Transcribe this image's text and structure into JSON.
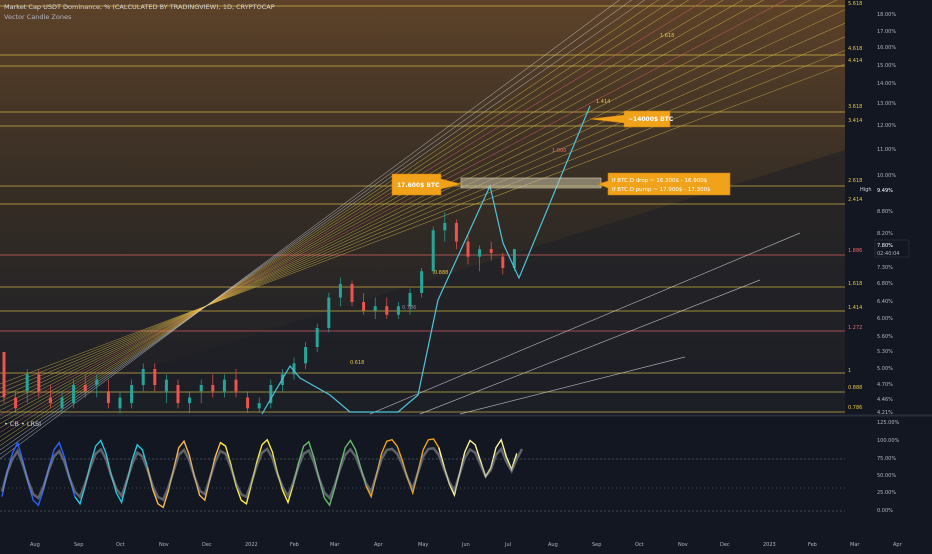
{
  "header": {
    "symbol_line": "Market Cap USDT Dominance, %  (CALCULATED BY TRADINGVIEW), 1D, CRYPTOCAP",
    "indicator_line": "Vector Candle Zones"
  },
  "oscillator": {
    "label": "• CB • LRSI",
    "axis_labels": [
      "125.00%",
      "100.00%",
      "75.00%",
      "50.00%",
      "25.00%",
      "0.00%"
    ]
  },
  "price_axis": {
    "labels": [
      "18.00%",
      "17.00%",
      "16.00%",
      "15.00%",
      "14.00%",
      "13.00%",
      "12.00%",
      "11.00%",
      "10.00%",
      "8.80%",
      "8.20%",
      "7.30%",
      "6.80%",
      "6.40%",
      "6.00%",
      "5.60%",
      "5.30%",
      "5.00%",
      "4.70%",
      "4.46%",
      "4.21%"
    ],
    "high_label": "High",
    "high_value": "9.49%",
    "current_value": "7.80%",
    "countdown": "02:40:04"
  },
  "time_axis": {
    "labels": [
      "Aug",
      "Sep",
      "Oct",
      "Nov",
      "Dec",
      "2022",
      "Feb",
      "Mar",
      "Apr",
      "May",
      "Jun",
      "Jul",
      "Aug",
      "Sep",
      "Oct",
      "Nov",
      "Dec",
      "2023",
      "Feb",
      "Mar",
      "Apr"
    ]
  },
  "fib_levels": [
    "5.618",
    "4.618",
    "4.414",
    "3.618",
    "3.414",
    "2.618",
    "2.414",
    "1.886",
    "1.618",
    "1.414",
    "1.272",
    "1",
    "0.888",
    "0.786"
  ],
  "chart_labels": {
    "diag_1618": "1.618",
    "diag_1414": "1.414",
    "diag_1000": "1.000",
    "level_0888": "0.888",
    "level_0786": "0.786",
    "level_0618": "0.618"
  },
  "annotations": {
    "target_btc": "~14000$ BTC",
    "zone_btc": "17.600$ BTC",
    "drop_text": "If BTC.D drop ~ 16.300$ - 16.900$",
    "pump_text": "If BTC.D pump ~ 17.900$ - 17.300$"
  },
  "colors": {
    "background": "#131722",
    "fib_line": "#e8c547",
    "fib_red": "#f06a6a",
    "projection": "#4fc3d9",
    "callout": "#f0a21b",
    "candle_up": "#26a69a",
    "candle_down": "#ef5350"
  },
  "chart_data": [
    {
      "type": "candlestick",
      "title": "Market Cap USDT Dominance, %  (CALCULATED BY TRADINGVIEW), 1D, CRYPTOCAP",
      "x": [
        "Aug",
        "Sep",
        "Oct",
        "Nov",
        "Dec",
        "2022",
        "Feb",
        "Mar",
        "Apr",
        "May",
        "Jun",
        "Jul"
      ],
      "y_unit": "%",
      "ylim": [
        4.21,
        18.0
      ],
      "last_value": 7.8,
      "high_value": 9.49,
      "series": [
        {
          "values": [
            [
              5.3,
              5.3,
              4.4,
              4.5
            ],
            [
              4.5,
              4.6,
              4.2,
              4.3
            ],
            [
              4.6,
              5.0,
              4.4,
              4.9
            ],
            [
              4.9,
              5.0,
              4.5,
              4.6
            ],
            [
              4.5,
              4.7,
              4.3,
              4.4
            ],
            [
              4.3,
              4.6,
              4.2,
              4.5
            ],
            [
              4.4,
              4.8,
              4.3,
              4.7
            ],
            [
              4.7,
              4.9,
              4.5,
              4.6
            ],
            [
              4.7,
              4.9,
              4.5,
              4.8
            ],
            [
              4.6,
              4.8,
              4.3,
              4.4
            ],
            [
              4.3,
              4.6,
              4.2,
              4.5
            ],
            [
              4.4,
              4.8,
              4.3,
              4.7
            ],
            [
              4.7,
              5.1,
              4.6,
              5.0
            ],
            [
              5.0,
              5.1,
              4.6,
              4.7
            ],
            [
              4.6,
              4.9,
              4.4,
              4.8
            ],
            [
              4.7,
              4.8,
              4.3,
              4.4
            ],
            [
              4.4,
              4.6,
              4.2,
              4.5
            ],
            [
              4.6,
              4.8,
              4.4,
              4.7
            ],
            [
              4.7,
              4.9,
              4.5,
              4.6
            ],
            [
              4.6,
              4.9,
              4.5,
              4.8
            ],
            [
              4.8,
              5.0,
              4.5,
              4.6
            ],
            [
              4.5,
              4.6,
              4.2,
              4.3
            ],
            [
              4.3,
              4.5,
              4.2,
              4.4
            ],
            [
              4.4,
              4.8,
              4.3,
              4.7
            ],
            [
              4.7,
              5.0,
              4.6,
              4.9
            ],
            [
              4.9,
              5.2,
              4.8,
              5.1
            ],
            [
              5.1,
              5.5,
              5.0,
              5.4
            ],
            [
              5.4,
              5.9,
              5.3,
              5.8
            ],
            [
              5.8,
              6.6,
              5.7,
              6.5
            ],
            [
              6.5,
              7.0,
              6.3,
              6.8
            ],
            [
              6.8,
              6.9,
              6.3,
              6.4
            ],
            [
              6.4,
              6.6,
              6.1,
              6.2
            ],
            [
              6.2,
              6.5,
              6.0,
              6.3
            ],
            [
              6.3,
              6.5,
              6.0,
              6.1
            ],
            [
              6.1,
              6.4,
              6.0,
              6.3
            ],
            [
              6.3,
              6.7,
              6.1,
              6.6
            ],
            [
              6.6,
              7.3,
              6.5,
              7.2
            ],
            [
              7.2,
              8.4,
              7.1,
              8.3
            ],
            [
              8.3,
              8.8,
              8.0,
              8.5
            ],
            [
              8.5,
              8.6,
              7.8,
              8.0
            ],
            [
              8.0,
              8.2,
              7.4,
              7.6
            ],
            [
              7.6,
              7.9,
              7.2,
              7.8
            ],
            [
              7.8,
              8.0,
              7.5,
              7.7
            ],
            [
              7.6,
              7.7,
              7.1,
              7.3
            ],
            [
              7.3,
              7.8,
              7.2,
              7.8
            ]
          ]
        }
      ]
    },
    {
      "type": "line",
      "title": "• CB • LRSI",
      "y_unit": "%",
      "ylim": [
        0,
        125
      ],
      "series": [
        {
          "values": [
            20,
            55,
            80,
            95,
            70,
            40,
            15,
            8,
            30,
            60,
            85,
            95,
            75,
            45,
            20,
            10,
            35,
            65,
            90,
            98,
            80,
            50,
            25,
            12,
            40,
            70,
            92,
            85,
            60,
            30,
            10,
            5,
            28,
            58,
            88,
            97,
            78,
            48,
            22,
            15,
            45,
            75,
            95,
            90,
            65,
            35,
            15,
            10,
            38,
            68,
            92,
            99,
            82,
            52,
            28,
            12,
            36,
            66,
            90,
            96,
            74,
            44,
            18,
            8,
            32,
            62,
            88,
            98,
            85,
            60,
            35,
            20,
            50,
            80,
            97,
            99,
            90,
            70,
            45,
            25,
            55,
            85,
            99,
            100,
            88,
            62,
            38,
            22,
            52,
            82,
            98,
            92,
            70,
            48,
            60,
            88,
            99,
            75,
            58,
            80,
            99
          ]
        }
      ]
    }
  ]
}
